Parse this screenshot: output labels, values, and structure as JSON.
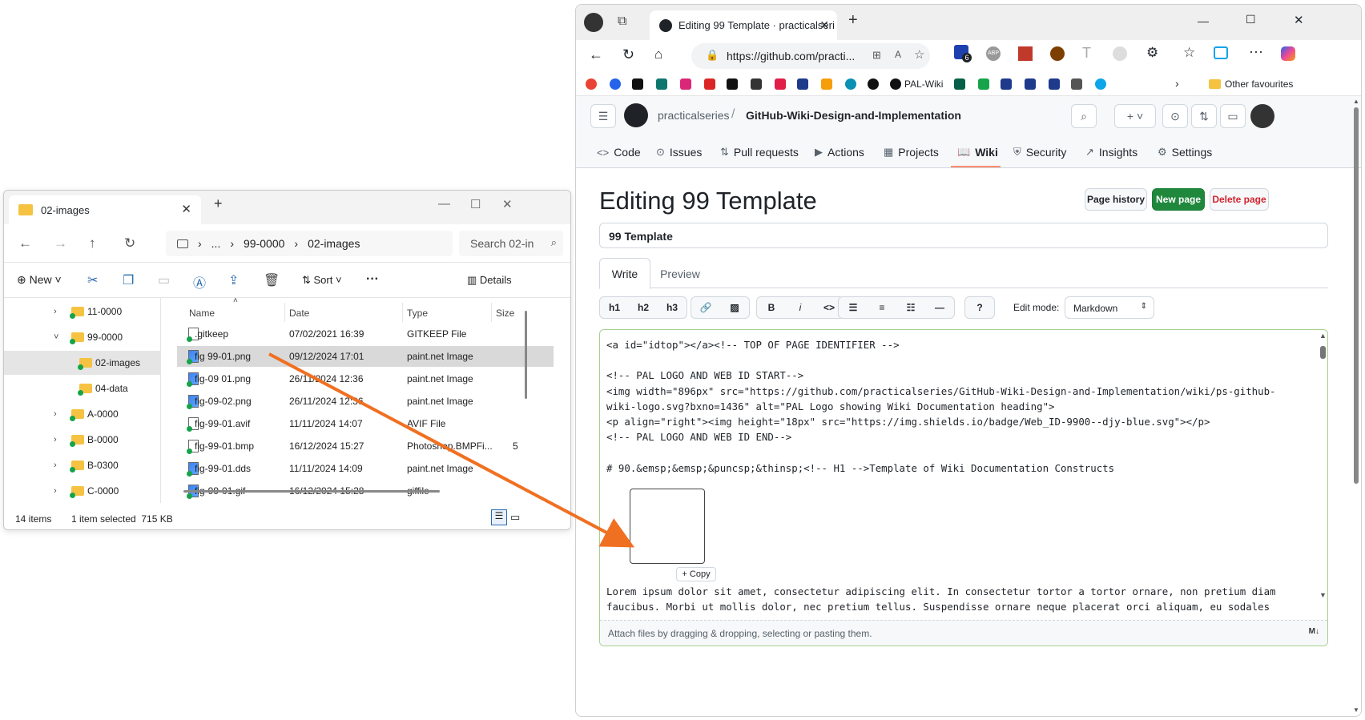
{
  "explorer": {
    "tab_title": "02-images",
    "breadcrumb": [
      "...",
      "99-0000",
      "02-images"
    ],
    "search_placeholder": "Search 02-in",
    "cmd": {
      "new_label": "New",
      "sort_label": "Sort",
      "more_label": "···",
      "details_label": "Details"
    },
    "tree": [
      {
        "label": "11-0000",
        "expanded": false
      },
      {
        "label": "99-0000",
        "expanded": true
      },
      {
        "label": "02-images",
        "selected": true
      },
      {
        "label": "04-data"
      },
      {
        "label": "A-0000",
        "expanded": false
      },
      {
        "label": "B-0000",
        "expanded": false
      },
      {
        "label": "B-0300",
        "expanded": false
      },
      {
        "label": "C-0000",
        "expanded": false
      }
    ],
    "columns": [
      "Name",
      "Date",
      "Type",
      "Size"
    ],
    "files": [
      {
        "name": ".gitkeep",
        "date": "07/02/2021 16:39",
        "type": "GITKEEP File",
        "size": "",
        "image": false
      },
      {
        "name": "fig 99-01.png",
        "date": "09/12/2024 17:01",
        "type": "paint.net Image",
        "size": "",
        "image": true,
        "selected": true
      },
      {
        "name": "fig-09 01.png",
        "date": "26/11/2024 12:36",
        "type": "paint.net Image",
        "size": "",
        "image": true
      },
      {
        "name": "fig-09-02.png",
        "date": "26/11/2024 12:36",
        "type": "paint.net Image",
        "size": "",
        "image": true
      },
      {
        "name": "fig-99-01.avif",
        "date": "11/11/2024 14:07",
        "type": "AVIF File",
        "size": "",
        "image": false
      },
      {
        "name": "fig-99-01.bmp",
        "date": "16/12/2024 15:27",
        "type": "Photoshop.BMPFi...",
        "size": "5",
        "image": false
      },
      {
        "name": "fig-99-01.dds",
        "date": "11/11/2024 14:09",
        "type": "paint.net Image",
        "size": "",
        "image": true
      },
      {
        "name": "fig-99-01.gif",
        "date": "16/12/2024 15:28",
        "type": "giffile",
        "size": "",
        "image": true
      }
    ],
    "status": {
      "count": "14 items",
      "selection": "1 item selected  715 KB"
    }
  },
  "browser": {
    "tab_title": "Editing 99 Template · practicalseri",
    "url": "https://github.com/practi...",
    "favbar": {
      "pal_wiki": "PAL-Wiki",
      "other_favourites": "Other favourites"
    },
    "extension_badge": "6"
  },
  "github": {
    "owner": "practicalseries",
    "repo": "GitHub-Wiki-Design-and-Implementation",
    "nav": [
      "Code",
      "Issues",
      "Pull requests",
      "Actions",
      "Projects",
      "Wiki",
      "Security",
      "Insights",
      "Settings"
    ],
    "active_nav": "Wiki",
    "page_title": "Editing 99 Template",
    "buttons": {
      "history": "Page history",
      "new": "New page",
      "delete": "Delete page"
    },
    "title_value": "99 Template",
    "tabs": {
      "write": "Write",
      "preview": "Preview"
    },
    "format": {
      "h1": "h1",
      "h2": "h2",
      "h3": "h3",
      "bold": "B",
      "italic": "i",
      "code": "<>"
    },
    "edit_mode_label": "Edit mode:",
    "edit_mode_value": "Markdown",
    "editor_lines": [
      "<a id=\"idtop\"></a><!-- TOP OF PAGE IDENTIFIER -->",
      "",
      "<!-- PAL LOGO AND WEB ID START-->",
      "<img width=\"896px\" src=\"https://github.com/practicalseries/GitHub-Wiki-Design-and-Implementation/wiki/ps-github-",
      "wiki-logo.svg?bxno=1436\" alt=\"PAL Logo showing Wiki Documentation heading\">",
      "<p align=\"right\"><img height=\"18px\" src=\"https://img.shields.io/badge/Web_ID-9900--djy-blue.svg\"></p>",
      "<!-- PAL LOGO AND WEB ID END-->",
      "",
      "# 90.&emsp;&emsp;&puncsp;&thinsp;<!-- H1 -->Template of Wiki Documentation Constructs"
    ],
    "editor_lower_lines": [
      "Lorem ipsum dolor sit amet, consectetur adipiscing elit. In consectetur tortor a tortor ornare, non pretium diam",
      "faucibus. Morbi ut mollis dolor, nec pretium tellus. Suspendisse ornare neque placerat orci aliquam, eu sodales"
    ],
    "copy_label": "+ Copy",
    "attach_hint": "Attach files by dragging & dropping, selecting or pasting them.",
    "md_badge": "M↓"
  },
  "colors": {
    "accent": "#fd8c73",
    "green": "#1f883d",
    "danger": "#d1242f",
    "arrow": "#f07022",
    "editor_border": "#a8d08d"
  }
}
